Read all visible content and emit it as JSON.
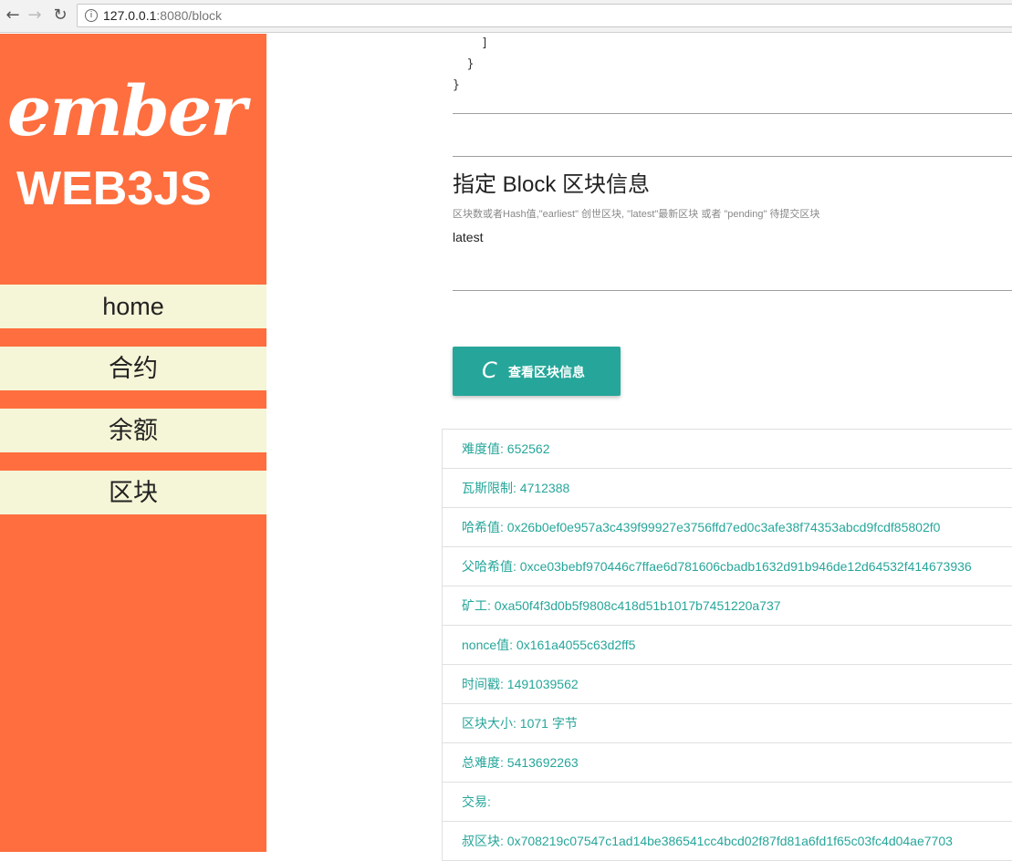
{
  "browser": {
    "back_icon": "arrow-left-icon",
    "forward_icon": "arrow-right-icon",
    "reload_icon": "reload-icon",
    "url_host": "127.0.0.1",
    "url_rest": ":8080/block"
  },
  "sidebar": {
    "logo_text": "ember",
    "app_title": "WEB3JS",
    "items": [
      {
        "label": "home"
      },
      {
        "label": "合约"
      },
      {
        "label": "余额"
      },
      {
        "label": "区块"
      }
    ]
  },
  "code_tail": {
    "line1": "    ]",
    "line2": "  }",
    "line3": "}"
  },
  "block_section": {
    "title": "指定 Block 区块信息",
    "hint": "区块数或者Hash值,\"earliest\" 创世区块, \"latest\"最新区块 或者 \"pending\" 待提交区块",
    "input_value": "latest",
    "button_icon": "C",
    "button_label": "查看区块信息"
  },
  "results": [
    {
      "text": "难度值: 652562"
    },
    {
      "text": "瓦斯限制: 4712388"
    },
    {
      "text": "哈希值: 0x26b0ef0e957a3c439f99927e3756ffd7ed0c3afe38f74353abcd9fcdf85802f0"
    },
    {
      "text": "父哈希值: 0xce03bebf970446c7ffae6d781606cbadb1632d91b946de12d64532f414673936"
    },
    {
      "text": "矿工: 0xa50f4f3d0b5f9808c418d51b1017b7451220a737"
    },
    {
      "text": "nonce值: 0x161a4055c63d2ff5"
    },
    {
      "text": "时间戳: 1491039562"
    },
    {
      "text": "区块大小: 1071 字节"
    },
    {
      "text": "总难度: 5413692263"
    },
    {
      "text": "交易:"
    },
    {
      "text": "叔区块: 0x708219c07547c1ad14be386541cc4bcd02f87fd81a6fd1f65c03fc4d04ae7703"
    }
  ],
  "colors": {
    "sidebar_bg": "#ff6e3e",
    "nav_item_bg": "#f5f5d7",
    "accent_teal": "#26a69a"
  }
}
